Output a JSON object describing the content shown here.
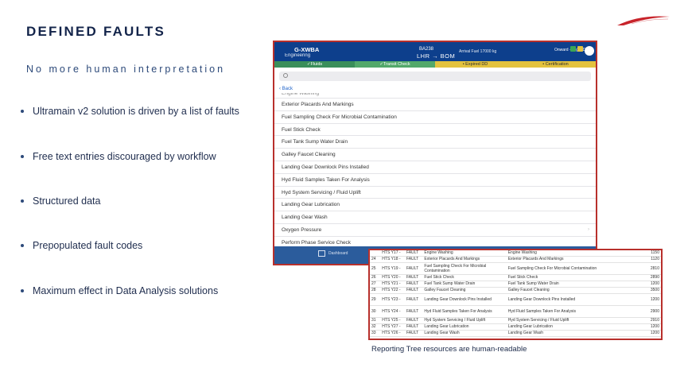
{
  "slide": {
    "title": "DEFINED FAULTS",
    "subtitle": "No more human interpretation",
    "bullets": [
      "Ultramain v2 solution is driven by a list of faults",
      "Free text entries discouraged by workflow",
      "Structured data",
      "Prepopulated fault codes",
      "Maximum effect in Data Analysis solutions"
    ],
    "caption": "Reporting Tree resources are human-readable"
  },
  "app": {
    "registration": "G-XWBA",
    "sub": "Engineering",
    "flight": "BA238",
    "route": "LHR → BOM",
    "fuel": "Arrival Fuel 17000 kg",
    "right_info": "Onward · Flight Deck",
    "status": [
      "✓Fluids",
      "✓Transit Check",
      "• Expired DD",
      "• Certification"
    ],
    "back_label": "Back",
    "list": [
      "Engine Washing",
      "Exterior Placards And Markings",
      "Fuel Sampling Check For Microbial Contamination",
      "Fuel Stick Check",
      "Fuel Tank Sump Water Drain",
      "Galley Faucet Cleaning",
      "Landing Gear Downlock Pins Installed",
      "Hyd Fluid Samples Taken For Analysis",
      "Hyd System Servicing / Fluid Uplift",
      "Landing Gear Lubrication",
      "Landing Gear Wash",
      "Oxygen Pressure",
      "Perform Phase Service Check"
    ],
    "bottom_label": "Dashboard"
  },
  "tree": {
    "rows": [
      [
        "",
        "HTS Y17 -",
        "FAULT",
        "Engine Washing",
        "Engine Washing",
        "1150"
      ],
      [
        "24",
        "HTS Y18 -",
        "FAULT",
        "Exterior Placards And Markings",
        "Exterior Placards And Markings",
        "1120"
      ],
      [
        "25",
        "HTS Y19 -",
        "FAULT",
        "Fuel Sampling Check For Microbial Contamination",
        "Fuel Sampling Check For Microbial Contamination",
        "2810"
      ],
      [
        "26",
        "HTS Y20 -",
        "FAULT",
        "Fuel Stick Check",
        "Fuel Stick Check",
        "2890"
      ],
      [
        "27",
        "HTS Y21 -",
        "FAULT",
        "Fuel Tank Sump Water Drain",
        "Fuel Tank Sump Water Drain",
        "1200"
      ],
      [
        "28",
        "HTS Y22 -",
        "FAULT",
        "Galley Faucet Cleaning",
        "Galley Faucet Cleaning",
        "3500"
      ],
      [
        "29",
        "HTS Y23 -",
        "FAULT",
        "Landing Gear Downlock Pins Installed",
        "Landing Gear Downlock Pins Installed",
        "1200"
      ],
      [
        "30",
        "HTS Y24 -",
        "FAULT",
        "Hyd Fluid Samples Taken For Analysis",
        "Hyd Fluid Samples Taken For Analysis",
        "2900"
      ],
      [
        "31",
        "HTS Y25 -",
        "FAULT",
        "Hyd System Servicing / Fluid Uplift",
        "Hyd System Servicing / Fluid Uplift",
        "2910"
      ],
      [
        "32",
        "HTS Y27 -",
        "FAULT",
        "Landing Gear Lubrication",
        "Landing Gear Lubrication",
        "1200"
      ],
      [
        "33",
        "HTS Y26 -",
        "FAULT",
        "Landing Gear Wash",
        "Landing Gear Wash",
        "1200"
      ]
    ]
  },
  "colors": {
    "brand_navy": "#13244a",
    "border_red": "#b8302c",
    "app_blue": "#0d3f8c",
    "logo_red": "#c8242b"
  }
}
